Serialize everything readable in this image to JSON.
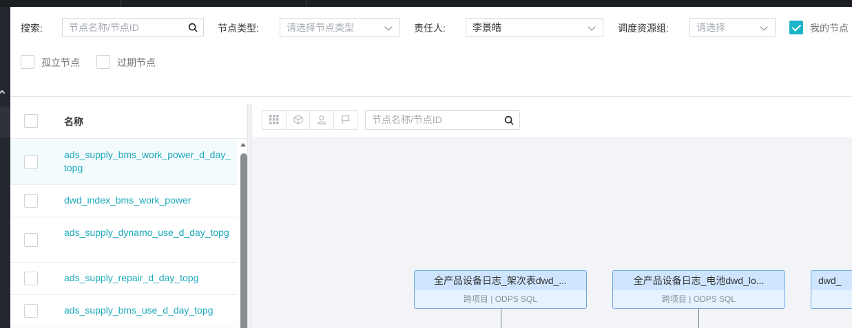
{
  "filters": {
    "search_label": "搜索:",
    "search_placeholder": "节点名称/节点ID",
    "type_label": "节点类型:",
    "type_placeholder": "请选择节点类型",
    "owner_label": "责任人:",
    "owner_value": "李景皓",
    "resgroup_label": "调度资源组:",
    "resgroup_placeholder": "请选择",
    "my_nodes_label": "我的节点",
    "isolated_label": "孤立节点",
    "expired_label": "过期节点",
    "my_nodes_checked": true
  },
  "list": {
    "header": "名称",
    "rows": [
      {
        "name": "ads_supply_bms_work_power_d_day_topg"
      },
      {
        "name": "dwd_index_bms_work_power"
      },
      {
        "name": "ads_supply_dynamo_use_d_day_topg"
      },
      {
        "name": "ads_supply_repair_d_day_topg"
      },
      {
        "name": "ads_supply_bms_use_d_day_topg"
      }
    ]
  },
  "graph": {
    "search_placeholder": "节点名称/节点ID",
    "toolbar_icons": [
      "grid-icon",
      "cube-icon",
      "user-icon",
      "flag-icon"
    ],
    "nodes": [
      {
        "title": "全产品设备日志_架次表dwd_...",
        "sub": "跨项目 | ODPS SQL"
      },
      {
        "title": "全产品设备日志_电池dwd_lo...",
        "sub": "跨项目 | ODPS SQL"
      },
      {
        "title": "dwd_",
        "sub": ""
      }
    ]
  },
  "colors": {
    "accent": "#1bb4c8",
    "link": "#1ba8bb",
    "node_border": "#6fa6e0",
    "node_header": "#cfe5ff"
  }
}
